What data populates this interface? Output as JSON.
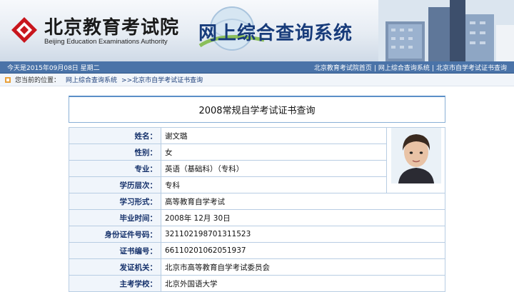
{
  "header": {
    "org_name_cn": "北京教育考试院",
    "org_name_en": "Beijing Education Examinations Authority",
    "site_title": "网上综合查询系统"
  },
  "navbar": {
    "date_text": "今天是2015年09月08日 星期二",
    "links": [
      "北京教育考试院首页",
      "网上综合查询系统",
      "北京市自学考试证书查询"
    ]
  },
  "breadcrumb": {
    "label": "您当前的位置：",
    "items": [
      "网上综合查询系统",
      ">>北京市自学考试证书查询"
    ]
  },
  "page": {
    "title": "2008常规自学考试证书查询"
  },
  "record": [
    {
      "label": "姓名：",
      "value": "谢文璐"
    },
    {
      "label": "性别：",
      "value": "女"
    },
    {
      "label": "专业：",
      "value": "英语（基础科）（专科）"
    },
    {
      "label": "学历层次：",
      "value": "专科"
    },
    {
      "label": "学习形式：",
      "value": "高等教育自学考试"
    },
    {
      "label": "毕业时间：",
      "value": "2008年 12月 30日"
    },
    {
      "label": "身份证件号码：",
      "value": "321102198701311523"
    },
    {
      "label": "证书编号：",
      "value": "66110201062051937"
    },
    {
      "label": "发证机关：",
      "value": "北京市高等教育自学考试委员会"
    },
    {
      "label": "主考学校：",
      "value": "北京外国语大学"
    }
  ],
  "colors": {
    "nav_bar": "#4a73a8",
    "label_text": "#15316b",
    "table_border": "#b8cde3"
  }
}
